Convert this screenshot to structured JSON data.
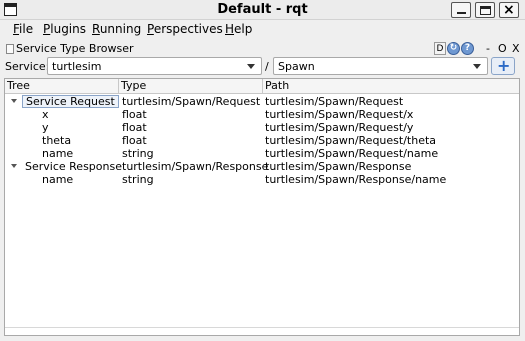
{
  "window": {
    "title": "Default - rqt",
    "min_glyph": "_",
    "max_glyph": "□",
    "close_glyph": "×"
  },
  "menu": {
    "items": [
      {
        "key": "F",
        "rest": "ile"
      },
      {
        "key": "P",
        "rest": "lugins"
      },
      {
        "key": "R",
        "rest": "unning"
      },
      {
        "key": "P",
        "rest": "erspectives"
      },
      {
        "key": "H",
        "rest": "elp"
      }
    ]
  },
  "plugin": {
    "title": "Service Type Browser",
    "d_label": "D",
    "dash_label": "-",
    "o_label": "O",
    "x_label": "X",
    "help_glyph": "?",
    "refresh_glyph": "↻"
  },
  "service": {
    "label": "Service:",
    "selected_service": "turtlesim",
    "separator": "/",
    "selected_type": "Spawn",
    "add_glyph": "+"
  },
  "tree": {
    "columns": [
      "Tree",
      "Type",
      "Path"
    ],
    "rows": [
      {
        "name": "Service Request",
        "type": "turtlesim/Spawn/Request",
        "path": "turtlesim/Spawn/Request"
      },
      {
        "name": "x",
        "type": "float",
        "path": "turtlesim/Spawn/Request/x"
      },
      {
        "name": "y",
        "type": "float",
        "path": "turtlesim/Spawn/Request/y"
      },
      {
        "name": "theta",
        "type": "float",
        "path": "turtlesim/Spawn/Request/theta"
      },
      {
        "name": "name",
        "type": "string",
        "path": "turtlesim/Spawn/Request/name"
      },
      {
        "name": "Service Response",
        "type": "turtlesim/Spawn/Response",
        "path": "turtlesim/Spawn/Response"
      },
      {
        "name": "name",
        "type": "string",
        "path": "turtlesim/Spawn/Response/name"
      }
    ]
  }
}
